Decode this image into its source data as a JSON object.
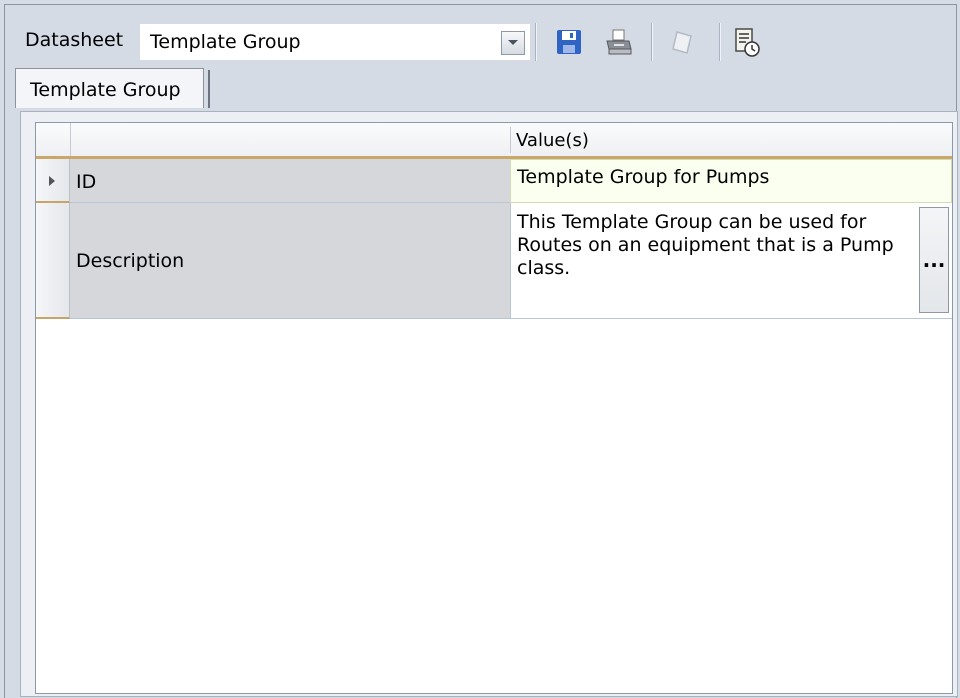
{
  "toolbar": {
    "datasheet_label": "Datasheet",
    "datasheet_value": "Template Group",
    "icons": [
      "chevron-down-icon",
      "save-icon",
      "print-icon",
      "clear-icon",
      "schedule-icon"
    ]
  },
  "tabs": [
    {
      "label": "Template Group",
      "active": true
    }
  ],
  "grid": {
    "header": {
      "value_col": "Value(s)"
    },
    "rows": [
      {
        "name": "ID",
        "value": "Template Group for Pumps",
        "current": true
      },
      {
        "name": "Description",
        "value_lines": [
          "This Template Group can be used for",
          "Routes on an equipment that is a Pump",
          "class."
        ],
        "button": "..."
      }
    ]
  },
  "colors": {
    "background": "#d4dbe5",
    "row_name_bg": "#d5d7db",
    "header_underline": "#c9a76a"
  }
}
